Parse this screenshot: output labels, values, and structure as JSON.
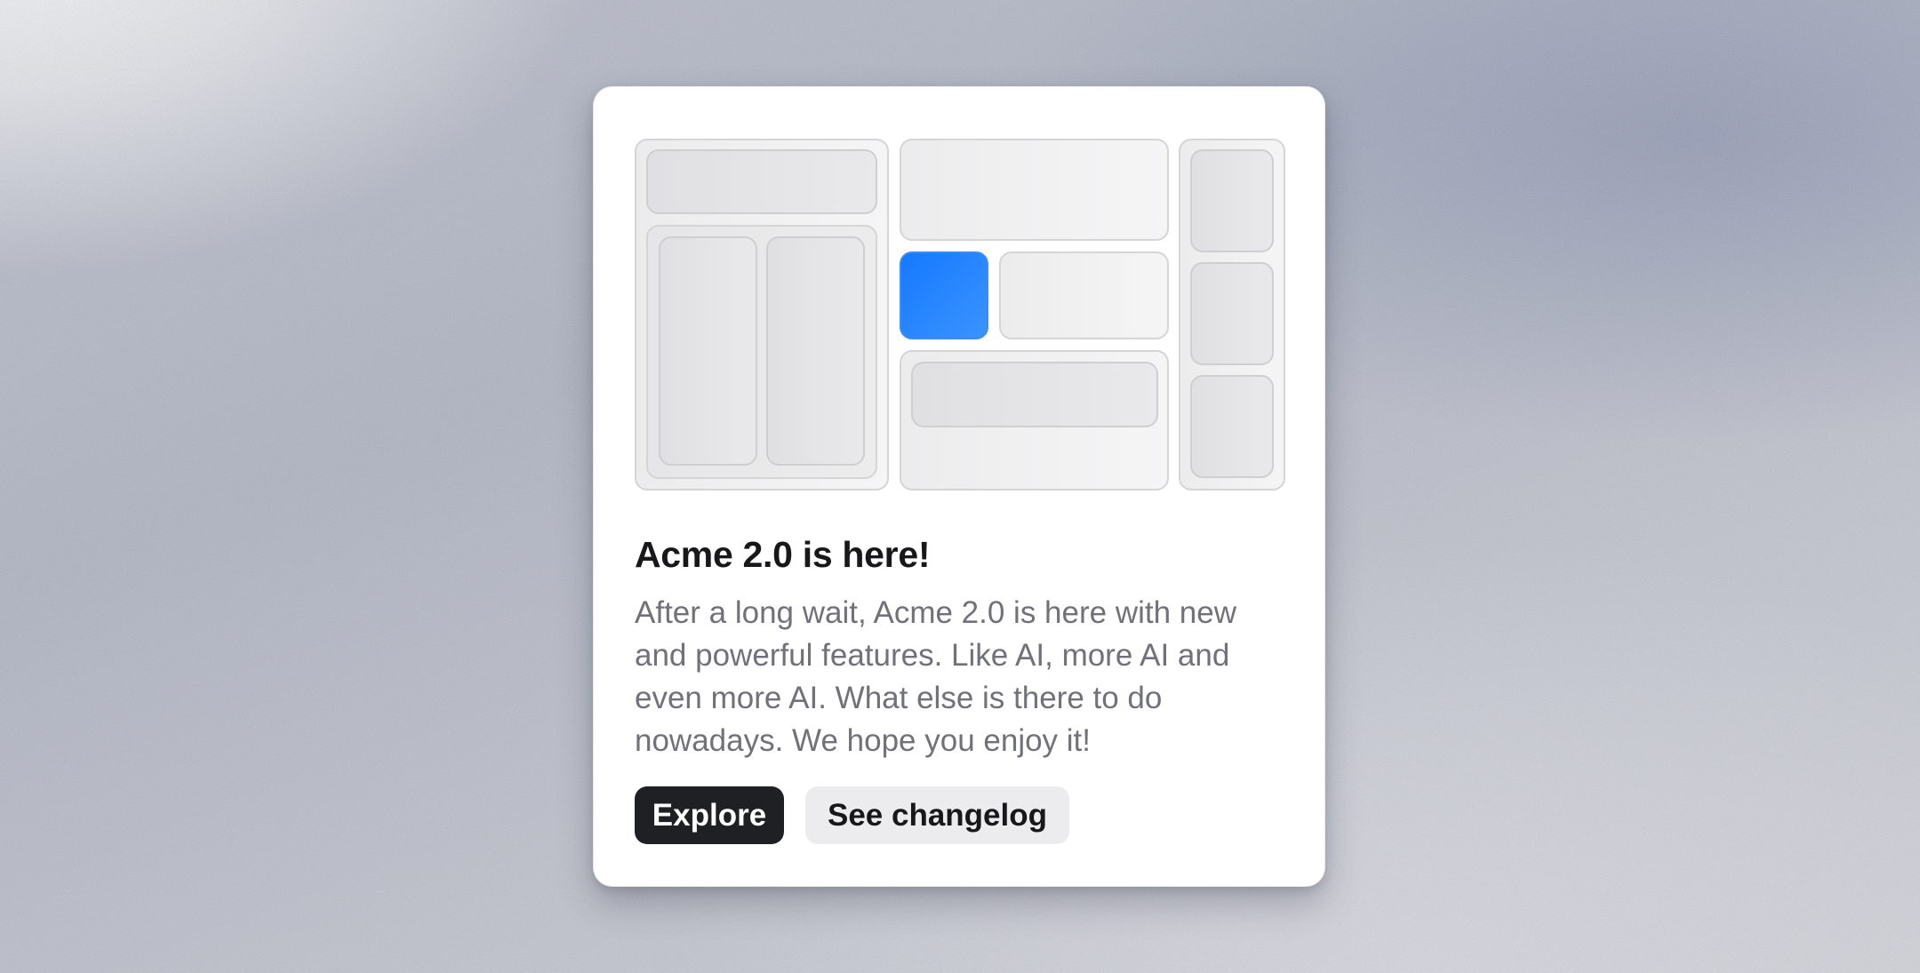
{
  "announcement": {
    "title": "Acme 2.0 is here!",
    "description": "After a long wait, Acme 2.0 is here with new and powerful features. Like AI, more AI and even more AI. What else is there to do nowadays. We hope you enjoy it!",
    "primary_button_label": "Explore",
    "secondary_button_label": "See changelog"
  },
  "colors": {
    "accent": "#1479ff",
    "primary_button_bg": "#1f2023",
    "secondary_button_bg": "#ececef",
    "title_text": "#18181b",
    "description_text": "#71717a"
  }
}
